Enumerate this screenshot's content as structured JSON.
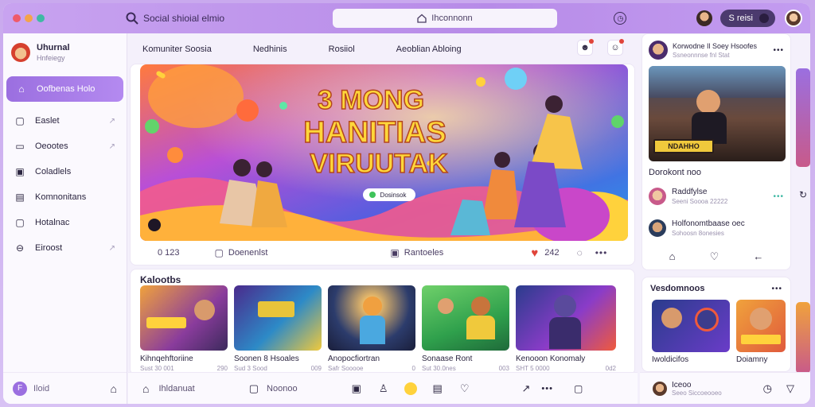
{
  "colors": {
    "accent": "#9b6fe0",
    "topbar": "#b78be8",
    "heart": "#e0443a"
  },
  "window": {
    "title": "Social shioial elmio",
    "search_text": "Ihconnonn",
    "profile_pill": "S reisi"
  },
  "sidebar": {
    "user": {
      "name": "Uhurnal",
      "sub": "Hnfeiegy"
    },
    "items": [
      {
        "label": "Oofbenas Holo",
        "icon": "home-icon",
        "active": true
      },
      {
        "label": "Easlet",
        "icon": "chat-icon"
      },
      {
        "label": "Oeootes",
        "icon": "image-icon"
      },
      {
        "label": "Coladlels",
        "icon": "square-icon"
      },
      {
        "label": "Komnonitans",
        "icon": "list-icon"
      },
      {
        "label": "Hotalnac",
        "icon": "bell-icon"
      },
      {
        "label": "Eiroost",
        "icon": "minus-circle-icon"
      }
    ],
    "bottom_label": "Iloid"
  },
  "main": {
    "tabs": [
      "Komuniter Soosia",
      "Nedhinis",
      "Rosiiol",
      "Aeoblian Abloing"
    ],
    "hero": {
      "headline": [
        "3 MONG",
        "HANITIAS",
        "VIRUUTAK"
      ],
      "button": "Dosinsok"
    },
    "hero_actions": {
      "count": "0 123",
      "comment_label": "Doenenlst",
      "save_label": "Rantoeles",
      "likes": "242"
    },
    "collection": {
      "title": "Kalootbs",
      "items": [
        {
          "caption": "Kihnqehftoriine",
          "meta_left": "Sust 30 001",
          "meta_right": "290"
        },
        {
          "caption": "Soonen 8 Hsoales",
          "meta_left": "Sud 3 Sood",
          "meta_right": "009"
        },
        {
          "caption": "Anopocfiortran",
          "meta_left": "Safr Sooooe",
          "meta_right": "0"
        },
        {
          "caption": "Sonaase Ront",
          "meta_left": "Sut 30.0nes",
          "meta_right": "003"
        },
        {
          "caption": "Kenooon Konomaly",
          "meta_left": "SHT 5 0000",
          "meta_right": "0d2"
        }
      ]
    },
    "bottom": {
      "label1": "Ihldanuat",
      "label2": "Noonoo"
    }
  },
  "right": {
    "post": {
      "title": "Korwodne Il Soey Hsoofes",
      "sub": "Ssneonnnse fnl Stat",
      "image_label": "NDAHHO",
      "caption": "Dorokont noo"
    },
    "comments": [
      {
        "name": "Raddfylse",
        "sub": "Seeni Soooa 22222"
      },
      {
        "name": "Holfonomtbaase oec",
        "sub": "Sohoosn 8onesies"
      }
    ],
    "recommend": {
      "title": "Vesdomnoos",
      "items": [
        {
          "caption": "Iwoldicifos"
        },
        {
          "caption": "Doiamny"
        }
      ]
    },
    "bottom": {
      "name": "Iceoo",
      "sub": "Seeo Siccoeooeo"
    }
  }
}
